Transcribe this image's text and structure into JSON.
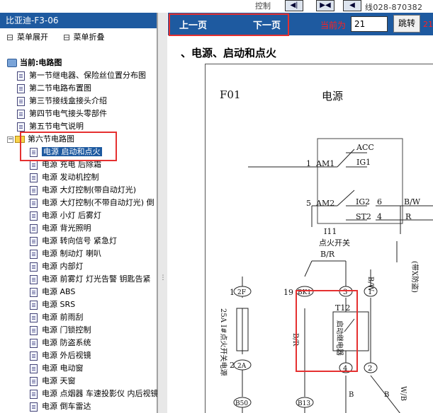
{
  "topbar": {
    "label_fragment": "控制",
    "nav_icons": [
      "step-first-icon",
      "step-prev-icon",
      "step-next-icon"
    ],
    "phone_line1": "线",
    "phone": "028-870382"
  },
  "sidebar": {
    "title": "比亚迪-F3-06",
    "expand_label": "菜单展开",
    "collapse_label": "菜单折叠",
    "current_label": "当前:电路图",
    "items": [
      "第一节继电器、保险丝位置分布图",
      "第二节电路布置图",
      "第三节接线盒接头介绍",
      "第四节电气接头零部件",
      "第五节电气说明"
    ],
    "folder_label": "第六节电路图",
    "sub_items": [
      "电源 启动和点火",
      "电源 充电 后除霜",
      "电源 发动机控制",
      "电源 大灯控制(带自动灯光)",
      "电源 大灯控制(不带自动灯光) 倒",
      "电源 小灯 后雾灯",
      "电源 背光照明",
      "电源 转向信号 紧急灯",
      "电源 制动灯 喇叭",
      "电源 内部灯",
      "电源 前雾灯 灯光告警 钥匙告紧",
      "电源 ABS",
      "电源 SRS",
      "电源 前雨刮",
      "电源 门锁控制",
      "电源 防盗系统",
      "电源 外后视镜",
      "电源 电动窗",
      "电源 天窗",
      "电源 点烟器 车速投影仪 内后视镜",
      "电源 倒车雷达"
    ]
  },
  "navbar": {
    "prev_label": "上一页",
    "next_label": "下一页",
    "current_label": "当前为",
    "page_value": "21",
    "go_label": "跳转",
    "total_fragment": "21"
  },
  "content": {
    "heading": "、电源、启动和点火",
    "diagram": {
      "code": "F01",
      "title": "电源",
      "acc": "ACC",
      "ig1": "IG1",
      "am1_num": "1",
      "am1": "AM1",
      "am2_num": "5",
      "am2": "AM2",
      "ig2": "IG2",
      "ig2_num": "6",
      "bw": "B/W",
      "st2": "ST2",
      "st2_num": "4",
      "r": "R",
      "switch_code": "I11",
      "switch_name": "点火开关",
      "br": "B/R",
      "bw_vertical": "B/W",
      "c2f": "2F",
      "c1": "1",
      "c19": "19",
      "cbk1": "BK1",
      "c3": "3",
      "c1b": "1",
      "fuse_label": "25A I#点火开关电源",
      "relay_code": "T12",
      "relay_name": "启动继电器",
      "br2": "B/R",
      "c2a": "2A",
      "c2": "2",
      "c4": "4",
      "c2b": "2",
      "b50": "B50",
      "b13": "B13",
      "b": "B",
      "b2": "B",
      "wb": "W/B",
      "side_text": "(带X防盗)"
    }
  },
  "colors": {
    "accent": "#1e5aa0",
    "highlight_box": "#e53030",
    "page_text": "#ff2020"
  }
}
